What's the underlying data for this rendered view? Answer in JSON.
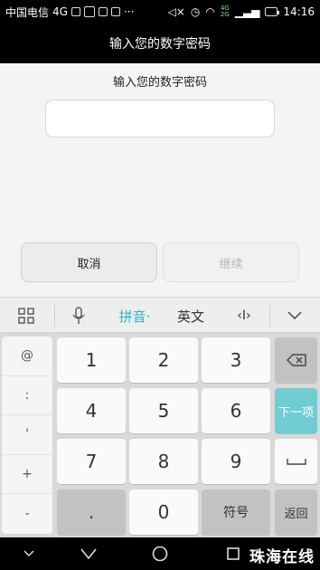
{
  "status_bar": {
    "carrier": "中国电信",
    "network": "4G",
    "network_small_top": "4G",
    "network_small_bottom": "2G",
    "time": "14:16"
  },
  "title": "输入您的数字密码",
  "dialog": {
    "prompt": "输入您的数字密码",
    "input_value": "",
    "cancel_label": "取消",
    "continue_label": "继续"
  },
  "keyboard": {
    "toolbar": {
      "grid_icon": "grid-icon",
      "mic_icon": "microphone-icon",
      "pinyin_label": "拼音·",
      "english_label": "英文",
      "cursor_label": "‹I›",
      "collapse_icon": "chevron-down-icon"
    },
    "side_keys": [
      "@",
      ":",
      "'",
      "+",
      "-"
    ],
    "digit_keys": [
      "1",
      "2",
      "3",
      "4",
      "5",
      "6",
      "7",
      "8",
      "9",
      "0"
    ],
    "dot_key": ".",
    "symbol_label": "符号",
    "backspace_icon": "backspace-icon",
    "next_label": "下一项",
    "space_icon": "space-icon",
    "return_label": "返回"
  },
  "nav_bar": {
    "watermark": "珠海在线"
  },
  "colors": {
    "accent": "#2fb3c4",
    "next_key": "#6fcdd2"
  }
}
